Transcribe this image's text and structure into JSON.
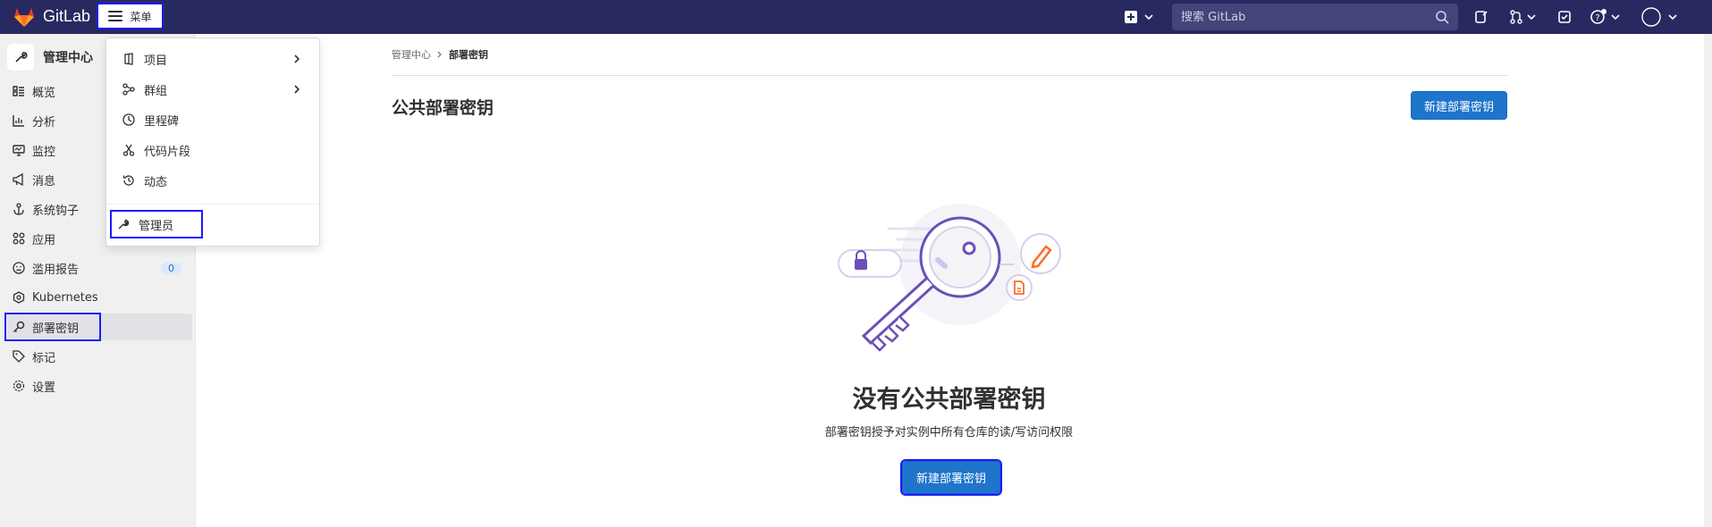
{
  "topbar": {
    "brand": "GitLab",
    "menu_label": "菜单",
    "search_placeholder": "搜索 GitLab"
  },
  "sidebar": {
    "title": "管理中心",
    "items": [
      {
        "label": "概览",
        "icon": "overview-icon"
      },
      {
        "label": "分析",
        "icon": "chart-icon"
      },
      {
        "label": "监控",
        "icon": "monitor-icon"
      },
      {
        "label": "消息",
        "icon": "bullhorn-icon"
      },
      {
        "label": "系统钩子",
        "icon": "anchor-icon"
      },
      {
        "label": "应用",
        "icon": "apps-icon"
      },
      {
        "label": "滥用报告",
        "icon": "abuse-icon",
        "badge": "0"
      },
      {
        "label": "Kubernetes",
        "icon": "kubernetes-icon"
      },
      {
        "label": "部署密钥",
        "icon": "key-icon",
        "active": true
      },
      {
        "label": "标记",
        "icon": "label-icon"
      },
      {
        "label": "设置",
        "icon": "gear-icon"
      }
    ]
  },
  "dropdown": {
    "items": [
      {
        "label": "项目",
        "icon": "project-icon",
        "submenu": true
      },
      {
        "label": "群组",
        "icon": "group-icon",
        "submenu": true
      },
      {
        "label": "里程碑",
        "icon": "clock-icon"
      },
      {
        "label": "代码片段",
        "icon": "snippet-icon"
      },
      {
        "label": "动态",
        "icon": "history-icon"
      }
    ],
    "admin_label": "管理员"
  },
  "breadcrumb": {
    "parent": "管理中心",
    "current": "部署密钥"
  },
  "page": {
    "title": "公共部署密钥",
    "new_button": "新建部署密钥",
    "empty_title": "没有公共部署密钥",
    "empty_desc": "部署密钥授予对实例中所有仓库的读/写访问权限",
    "empty_button": "新建部署密钥"
  },
  "colors": {
    "topbar": "#292961",
    "primary": "#1f75cb",
    "highlight": "#1a1aff",
    "illustration_purple": "#6b4fbb",
    "illustration_orange": "#fc6d26"
  }
}
